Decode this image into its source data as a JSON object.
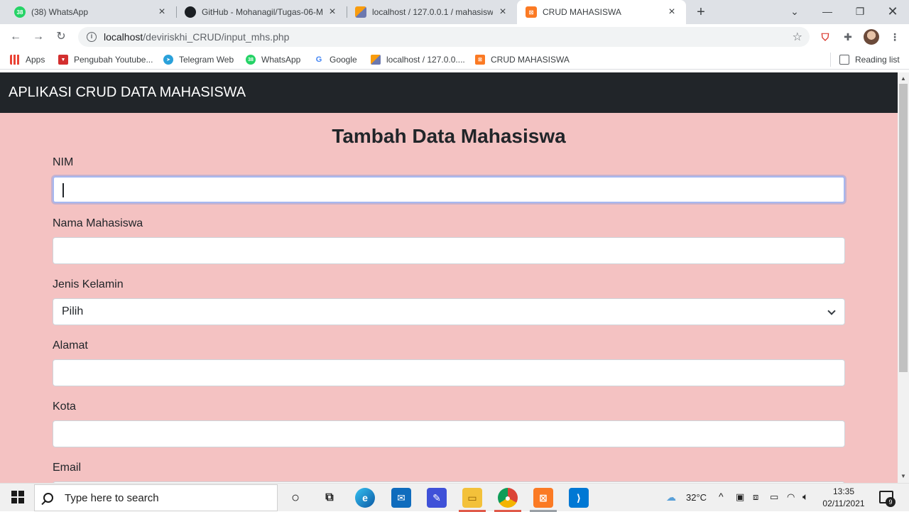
{
  "browser": {
    "tabs": [
      {
        "title": "(38) WhatsApp",
        "favicon": "whatsapp-icon",
        "badge": "38",
        "active": false
      },
      {
        "title": "GitHub - Mohanagil/Tugas-06-M",
        "favicon": "github-icon",
        "active": false
      },
      {
        "title": "localhost / 127.0.0.1 / mahasiswa",
        "favicon": "phpmyadmin-icon",
        "active": false
      },
      {
        "title": "CRUD MAHASISWA",
        "favicon": "xampp-icon",
        "active": true
      }
    ],
    "new_tab_label": "+",
    "address": {
      "host": "localhost",
      "path": "/deviriskhi_CRUD/input_mhs.php"
    },
    "bookmarks": [
      {
        "label": "Apps",
        "icon": "apps-grid-icon"
      },
      {
        "label": "Pengubah Youtube...",
        "icon": "youtube-converter-icon"
      },
      {
        "label": "Telegram Web",
        "icon": "telegram-icon"
      },
      {
        "label": "WhatsApp",
        "icon": "whatsapp-icon"
      },
      {
        "label": "Google",
        "icon": "google-icon"
      },
      {
        "label": "localhost / 127.0.0....",
        "icon": "phpmyadmin-icon"
      },
      {
        "label": "CRUD MAHASISWA",
        "icon": "xampp-icon"
      }
    ],
    "reading_list": "Reading list"
  },
  "app": {
    "brand": "APLIKASI CRUD DATA MAHASISWA",
    "heading": "Tambah Data Mahasiswa",
    "form": {
      "nim_label": "NIM",
      "nim_value": "",
      "nama_label": "Nama Mahasiswa",
      "nama_value": "",
      "jk_label": "Jenis Kelamin",
      "jk_selected": "Pilih",
      "alamat_label": "Alamat",
      "alamat_value": "",
      "kota_label": "Kota",
      "kota_value": "",
      "email_label": "Email"
    }
  },
  "taskbar": {
    "search_placeholder": "Type here to search",
    "weather": "32°C",
    "time": "13:35",
    "date": "02/11/2021",
    "notification_count": "9"
  },
  "colors": {
    "page_bg": "#f4c2c2",
    "navbar_bg": "#212529",
    "tab_strip_bg": "#dee1e6"
  }
}
